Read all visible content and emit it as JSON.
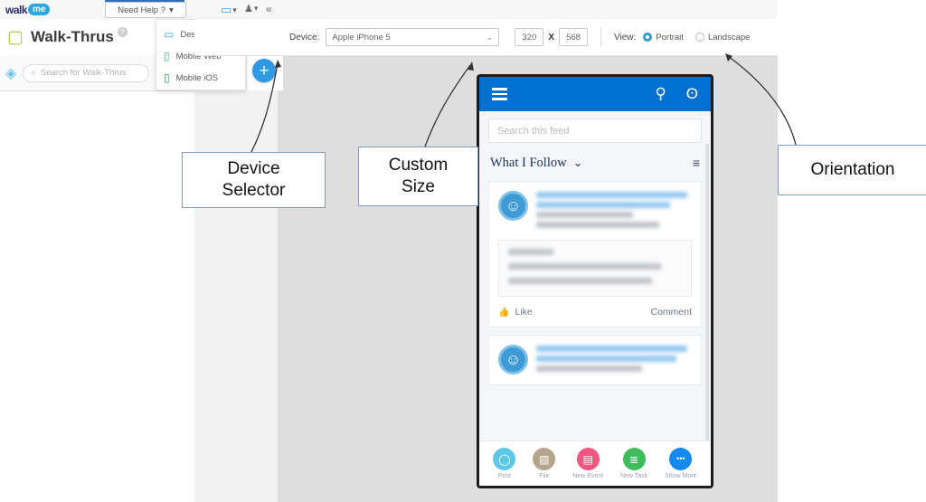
{
  "topbar": {
    "logo_text": "walk",
    "logo_pill": "me",
    "need_help": "Need Help ?",
    "need_help_caret": "▾",
    "monitor_icon": "▭",
    "monitor_caret": "▾",
    "user_icon": "♟",
    "user_caret": "▾",
    "collapse_icon": "«"
  },
  "left_panel": {
    "title": "Walk-Thrus",
    "help_badge": "?",
    "search_placeholder": "Search for Walk-Thrus",
    "search_icon": "⌕",
    "tag_icon": "◈",
    "chat_icon": "▢",
    "plus_label": "+"
  },
  "device_menu": {
    "items": [
      {
        "label": "Desktop",
        "icon": "▭",
        "color": "#3aaee0"
      },
      {
        "label": "Mobile Web",
        "icon": "▯",
        "color": "#3cb878"
      },
      {
        "label": "Mobile iOS",
        "icon": "▯",
        "color": "#1f9e5a"
      }
    ]
  },
  "device_toolbar": {
    "device_label": "Device:",
    "device_value": "Apple iPhone 5",
    "device_caret": "⌄",
    "width_value": "320",
    "x_separator": "X",
    "height_value": "568",
    "view_label": "View:",
    "options": [
      {
        "label": "Portrait",
        "selected": true
      },
      {
        "label": "Landscape",
        "selected": false
      }
    ]
  },
  "phone": {
    "header": {
      "menu_icon": "hamburger",
      "search_icon": "⚲",
      "bell_icon": "ʘ"
    },
    "feed_search_placeholder": "Search this feed",
    "filter_label": "What I Follow",
    "filter_caret": "⌄",
    "sort_icon": "≡",
    "posts": [
      {
        "author_redacted": true,
        "body_redacted": true,
        "has_attachment": true,
        "like_label": "Like",
        "like_icon": "👍",
        "comment_label": "Comment"
      },
      {
        "author_redacted": true,
        "body_redacted": true,
        "has_attachment": false
      }
    ],
    "bottom_bar": [
      {
        "label": "Post",
        "icon": "◯",
        "color": "#5bc8e8"
      },
      {
        "label": "File",
        "icon": "▧",
        "color": "#b3a68c"
      },
      {
        "label": "New Event",
        "icon": "▤",
        "color": "#f2557f"
      },
      {
        "label": "New Task",
        "icon": "≣",
        "color": "#3fbc5b"
      },
      {
        "label": "Show More",
        "icon": "•••",
        "color": "#1589ee"
      }
    ]
  },
  "callouts": {
    "device_selector": "Device\nSelector",
    "custom_size": "Custom\nSize",
    "orientation": "Orientation"
  },
  "colors": {
    "phone_header_blue": "#0070d2",
    "accent_blue": "#2f9ae0",
    "callout_border": "#7f9dc0",
    "canvas_gray": "#dedede"
  }
}
